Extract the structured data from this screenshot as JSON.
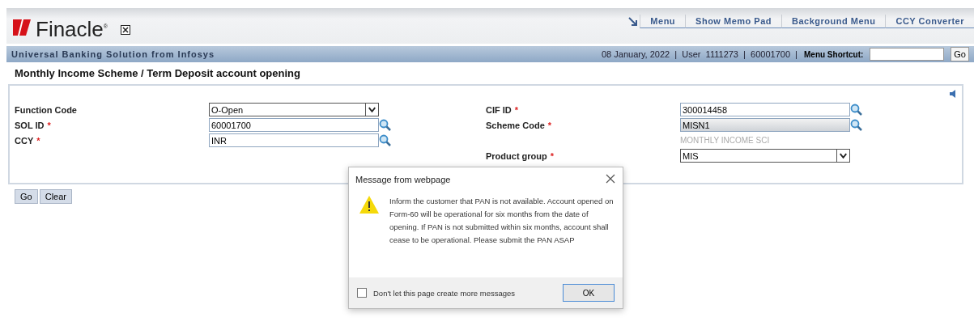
{
  "app": {
    "logo": "Finacle",
    "logo_mark": "®"
  },
  "top_menu": [
    {
      "label": "Menu"
    },
    {
      "label": "Show Memo Pad"
    },
    {
      "label": "Background Menu"
    },
    {
      "label": "CCY Converter"
    }
  ],
  "banner": {
    "title": "Universal Banking Solution from Infosys",
    "info": "08 January, 2022  |  User  1111273  |  60001700  |",
    "shortcut_label": "Menu Shortcut:",
    "go": "Go"
  },
  "page_title": "Monthly Income Scheme / Term Deposit account opening",
  "left_fields": [
    {
      "label": "Function Code",
      "kind": "select",
      "value": "O-Open",
      "required": false
    },
    {
      "label": "SOL ID",
      "kind": "lookup",
      "value": "60001700",
      "required": true,
      "disabled": false
    },
    {
      "label": "CCY",
      "kind": "lookup",
      "value": "INR",
      "required": true,
      "disabled": false
    }
  ],
  "right_fields": [
    {
      "label": "CIF ID",
      "kind": "lookup",
      "value": "300014458",
      "required": true,
      "disabled": false
    },
    {
      "label": "Scheme Code",
      "kind": "lookup",
      "value": "MISN1",
      "required": true,
      "disabled": true,
      "note": "MONTHLY INCOME SCI"
    },
    {
      "label": "Product group",
      "kind": "select",
      "value": "MIS",
      "required": true
    }
  ],
  "required_mark": "*",
  "actions": [
    "Go",
    "Clear"
  ],
  "dialog": {
    "title": "Message from webpage",
    "message": "Inform the customer that PAN is not available. Account opened on Form-60 will be operational for six months from the date of opening. If PAN is not submitted within six months, account shall cease to be operational. Please submit the PAN ASAP",
    "checkbox": {
      "label": "Don't let this page create more messages",
      "checked": false
    },
    "ok": "OK"
  }
}
